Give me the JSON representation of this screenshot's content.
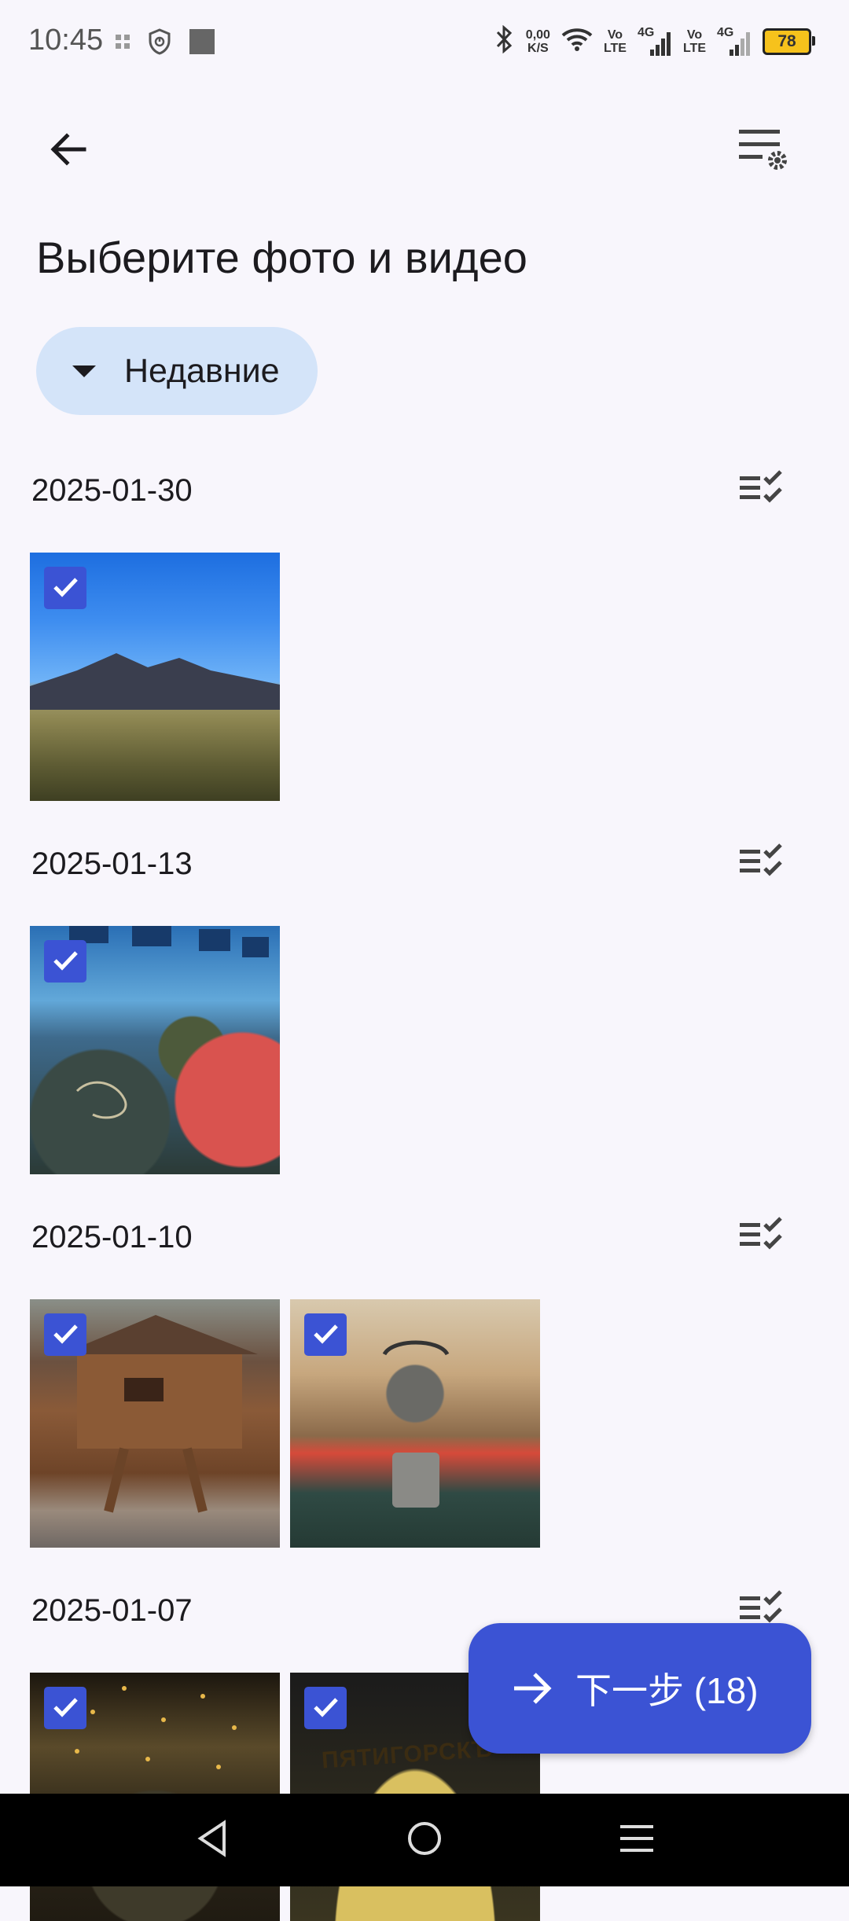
{
  "status_bar": {
    "time": "10:45",
    "net_speed_value": "0,00",
    "net_speed_unit": "K/S",
    "volte1_top": "Vo",
    "volte1_bottom": "LTE",
    "sig1_label": "4G",
    "volte2_top": "Vo",
    "volte2_bottom": "LTE",
    "sig2_label": "4G",
    "battery": "78",
    "icons": [
      "grid-icon",
      "shield-icon",
      "square-icon",
      "bluetooth-icon",
      "wifi-icon",
      "signal-icon",
      "battery-icon"
    ]
  },
  "toolbar": {
    "back_icon": "arrow-left-icon",
    "settings_icon": "list-settings-icon"
  },
  "page": {
    "title": "Выберите фото и видео"
  },
  "album_chip": {
    "label": "Недавние",
    "icon": "caret-down-icon"
  },
  "groups": [
    {
      "date": "2025-01-30",
      "photos": [
        {
          "name": "mountains-photo",
          "checked": true
        }
      ]
    },
    {
      "date": "2025-01-13",
      "photos": [
        {
          "name": "bowling-balls-photo",
          "checked": true
        }
      ]
    },
    {
      "date": "2025-01-10",
      "photos": [
        {
          "name": "wooden-cabin-photo",
          "checked": true
        },
        {
          "name": "camping-kettle-photo",
          "checked": true
        }
      ]
    },
    {
      "date": "2025-01-07",
      "photos": [
        {
          "name": "christmas-lights-photo",
          "checked": true
        },
        {
          "name": "pyatigorsk-sign-photo",
          "checked": true,
          "sign_text": "ПЯТИГОРСКЪ"
        }
      ]
    }
  ],
  "fab": {
    "label": "下一步 (18)",
    "icon": "arrow-right-icon"
  },
  "colors": {
    "accent": "#3b53d4",
    "chip_background": "#d4e4f9",
    "page_background": "#f8f6fc",
    "nav_bar": "#000000"
  }
}
